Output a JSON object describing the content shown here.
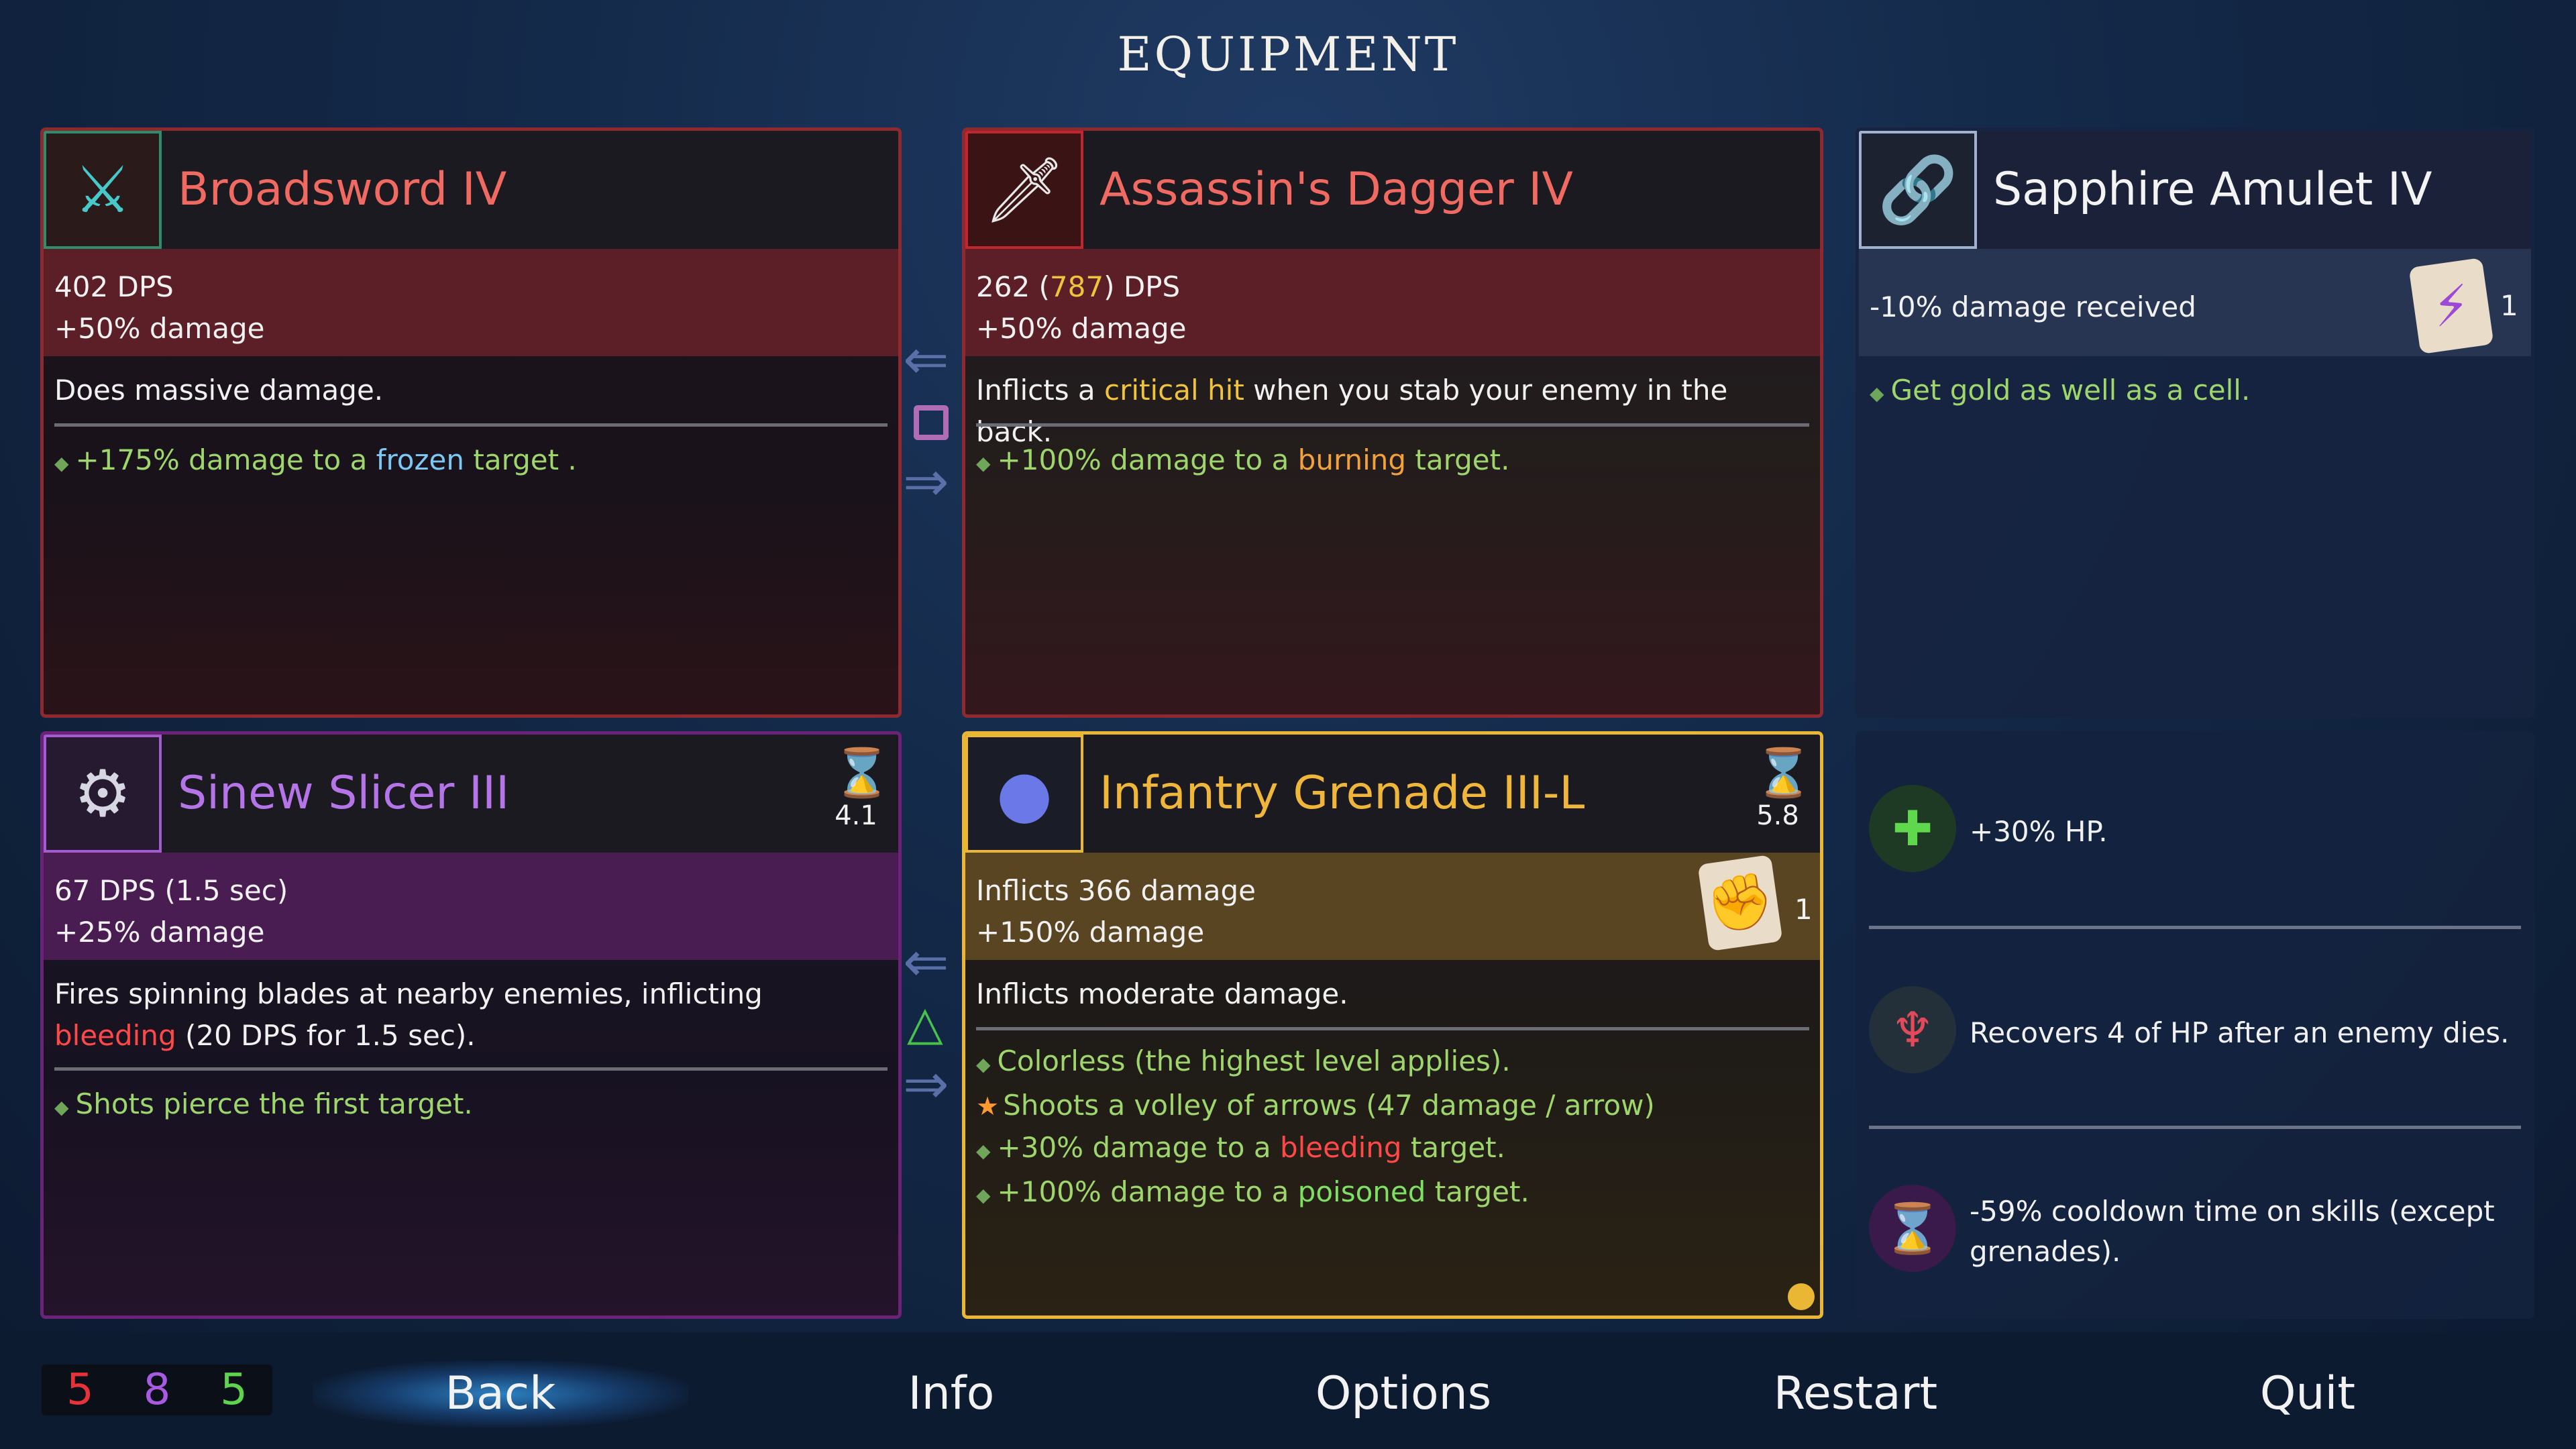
{
  "header": {
    "title": "EQUIPMENT"
  },
  "colors": {
    "melee_red": "#f06a62",
    "brutality": "#c8202b",
    "tactics": "#9c3fb8",
    "legendary_gold": "#e9b733",
    "survival_green": "#7ee062",
    "amulet_border": "#9fb3cf"
  },
  "slots": {
    "broadsword": {
      "name": "Broadsword IV",
      "icon": "broadsword-icon",
      "dps": "402 DPS",
      "damage": "+50% damage",
      "desc": "Does massive damage.",
      "bullet_pre": "+175% damage to a ",
      "bullet_hl": "frozen",
      "bullet_post": " target ."
    },
    "dagger": {
      "name": "Assassin's Dagger IV",
      "icon": "dagger-icon",
      "dps_pre": "262 (",
      "dps_crit": "787",
      "dps_post": ") DPS",
      "damage": "+50% damage",
      "desc_pre": "Inflicts a ",
      "desc_hl": "critical hit",
      "desc_post": " when you stab your enemy in the back.",
      "bullet_pre": "+100% damage to a ",
      "bullet_hl": "burning",
      "bullet_post": " target."
    },
    "amulet": {
      "name": "Sapphire Amulet IV",
      "icon": "amulet-icon",
      "stat": "-10% damage received",
      "scroll_icon": "lightning-scroll-icon",
      "scroll_count": "1",
      "bullet": "Get gold as well as a cell."
    },
    "sinew": {
      "name": "Sinew Slicer III",
      "icon": "sinew-slicer-icon",
      "cooldown": "4.1",
      "dps": "67 DPS (1.5 sec)",
      "damage": "+25% damage",
      "desc_pre": "Fires spinning blades at nearby enemies, inflicting ",
      "desc_hl": "bleeding",
      "desc_post": " (20 DPS for 1.5 sec).",
      "bullet": "Shots pierce the first target."
    },
    "grenade": {
      "name": "Infantry Grenade III-L",
      "icon": "grenade-icon",
      "cooldown": "5.8",
      "dmg": "Inflicts 366 damage",
      "damage": "+150% damage",
      "scroll_icon": "fist-scroll-icon",
      "scroll_count": "1",
      "desc": "Inflicts moderate damage.",
      "b1": "Colorless (the highest level applies).",
      "b2": "Shoots a volley of arrows (47 damage / arrow)",
      "b3_pre": "+30% damage to a ",
      "b3_hl": "bleeding",
      "b3_post": " target.",
      "b4_pre": "+100% damage to a ",
      "b4_hl": "poisoned",
      "b4_post": " target."
    }
  },
  "mutations": [
    {
      "icon": "hp-plus-icon",
      "text": "+30% HP."
    },
    {
      "icon": "vampire-fangs-icon",
      "text": "Recovers 4 of HP after an enemy dies."
    },
    {
      "icon": "cooldown-hourglass-icon",
      "text": "-59% cooldown time on skills (except grenades)."
    }
  ],
  "scrolls": {
    "brutality": "5",
    "tactics": "8",
    "survival": "5"
  },
  "nav": {
    "back": "Back",
    "info": "Info",
    "options": "Options",
    "restart": "Restart",
    "quit": "Quit"
  }
}
